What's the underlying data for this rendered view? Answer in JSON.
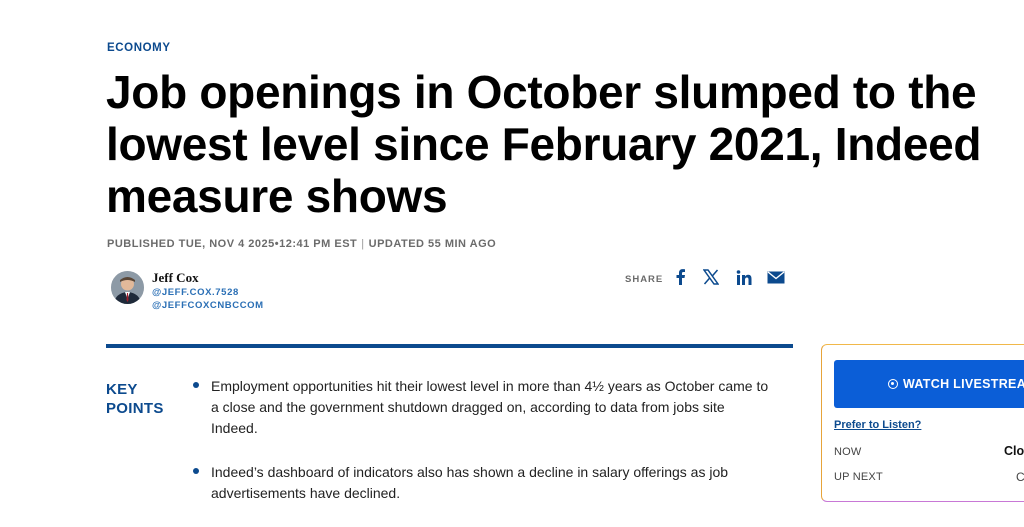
{
  "article": {
    "section": "ECONOMY",
    "headline": "Job openings in October slumped to the lowest level since February 2021, Indeed measure shows",
    "published": "PUBLISHED TUE, NOV 4 2025•12:41 PM EST",
    "separator": "|",
    "updated": "UPDATED 55 MIN AGO"
  },
  "author": {
    "name": "Jeff Cox",
    "handle_1": "@JEFF.COX.7528",
    "handle_2": "@JEFFCOXCNBCCOM"
  },
  "share": {
    "label": "SHARE",
    "icons": [
      "facebook-icon",
      "x-icon",
      "linkedin-icon",
      "email-icon"
    ]
  },
  "key_points": {
    "label_line1": "KEY",
    "label_line2": "POINTS",
    "items": [
      "Employment opportunities hit their lowest level in more than 4½ years as October came to a close and the government shutdown dragged on, according to data from jobs site Indeed.",
      "Indeed’s dashboard of indicators also has shown a decline in salary offerings as job advertisements have declined."
    ]
  },
  "livestream": {
    "button_label": "WATCH LIVESTREAM",
    "listen_link": "Prefer to Listen?",
    "now_label": "NOW",
    "now_value": "Clo",
    "next_label": "UP NEXT",
    "next_value": "C"
  },
  "colors": {
    "accent": "#0c4a8e",
    "button": "#0b5ed7"
  }
}
